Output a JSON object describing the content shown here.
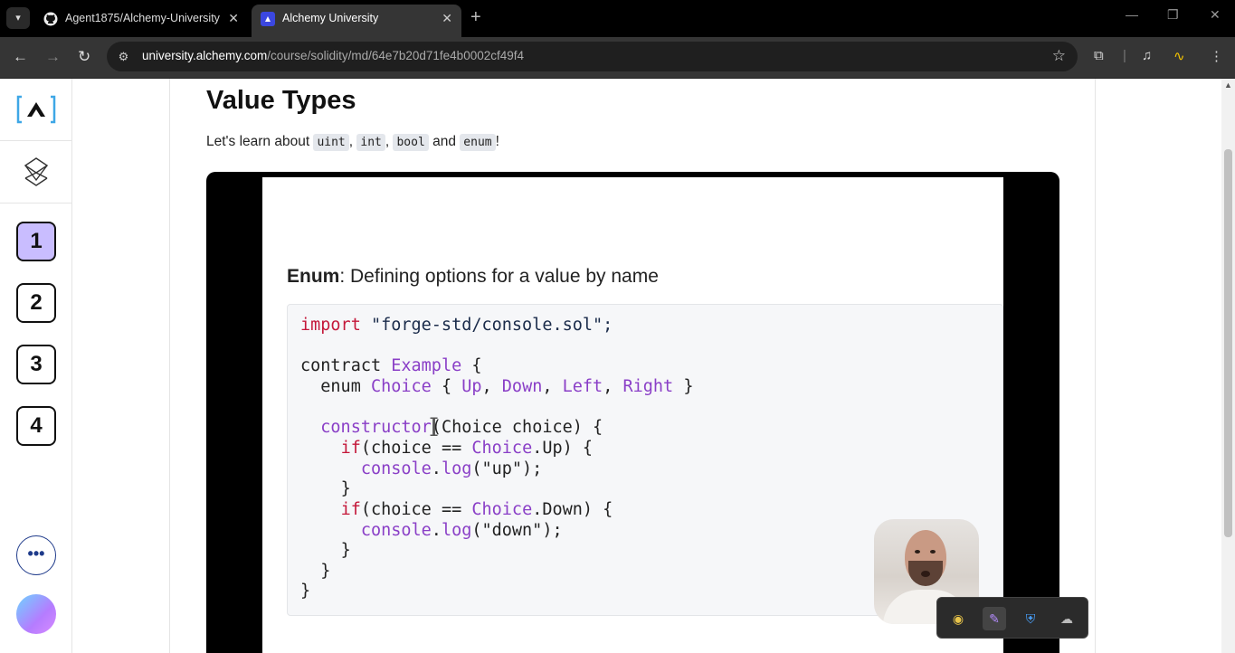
{
  "browser": {
    "tabs": [
      {
        "label": "Agent1875/Alchemy-University",
        "icon": "github-icon"
      },
      {
        "label": "Alchemy University",
        "icon": "alchemy-icon"
      }
    ],
    "url_host": "university.alchemy.com",
    "url_path": "/course/solidity/md/64e7b20d71fe4b0002cf49f4"
  },
  "sidebar": {
    "steps": [
      "1",
      "2",
      "3",
      "4"
    ],
    "active_step": "1",
    "more_label": "•••"
  },
  "lesson": {
    "title": "Value Types",
    "intro_prefix": "Let's learn about",
    "types": [
      "uint",
      "int",
      "bool",
      "enum"
    ],
    "sep1": ",",
    "sep2": ",",
    "and_word": "and",
    "intro_suffix": "!"
  },
  "video": {
    "slide_title_bold": "Enum",
    "slide_title_rest": ": Defining options for a value by name",
    "code": {
      "l1_kw": "import",
      "l1_str": "\"forge-std/console.sol\";",
      "l3_kw": "contract",
      "l3_name": "Example",
      "l3_brace": "{",
      "l4_kw": "enum",
      "l4_name": "Choice",
      "l4_open": "{",
      "l4_up": "Up",
      "l4_down": "Down",
      "l4_left": "Left",
      "l4_right": "Right",
      "l4_close": "}",
      "l6_kw": "constructor",
      "l6_rest": "(Choice choice) {",
      "l7_kw": "if",
      "l7_mid": "(choice == ",
      "l7_name": "Choice",
      "l7_rest": ".Up) {",
      "l8_obj": "console",
      "l8_dot": ".",
      "l8_fn": "log",
      "l8_rest": "(\"up\");",
      "l9": "}",
      "l10_kw": "if",
      "l10_mid": "(choice == ",
      "l10_name": "Choice",
      "l10_rest": ".Down) {",
      "l11_obj": "console",
      "l11_dot": ".",
      "l11_fn": "log",
      "l11_rest": "(\"down\");",
      "l12": "}",
      "l13": "}",
      "l14": "}"
    }
  },
  "colors": {
    "active_step_bg": "#c9bdff",
    "keyword_red": "#c4183a",
    "identifier_purple": "#8a3fc7"
  }
}
